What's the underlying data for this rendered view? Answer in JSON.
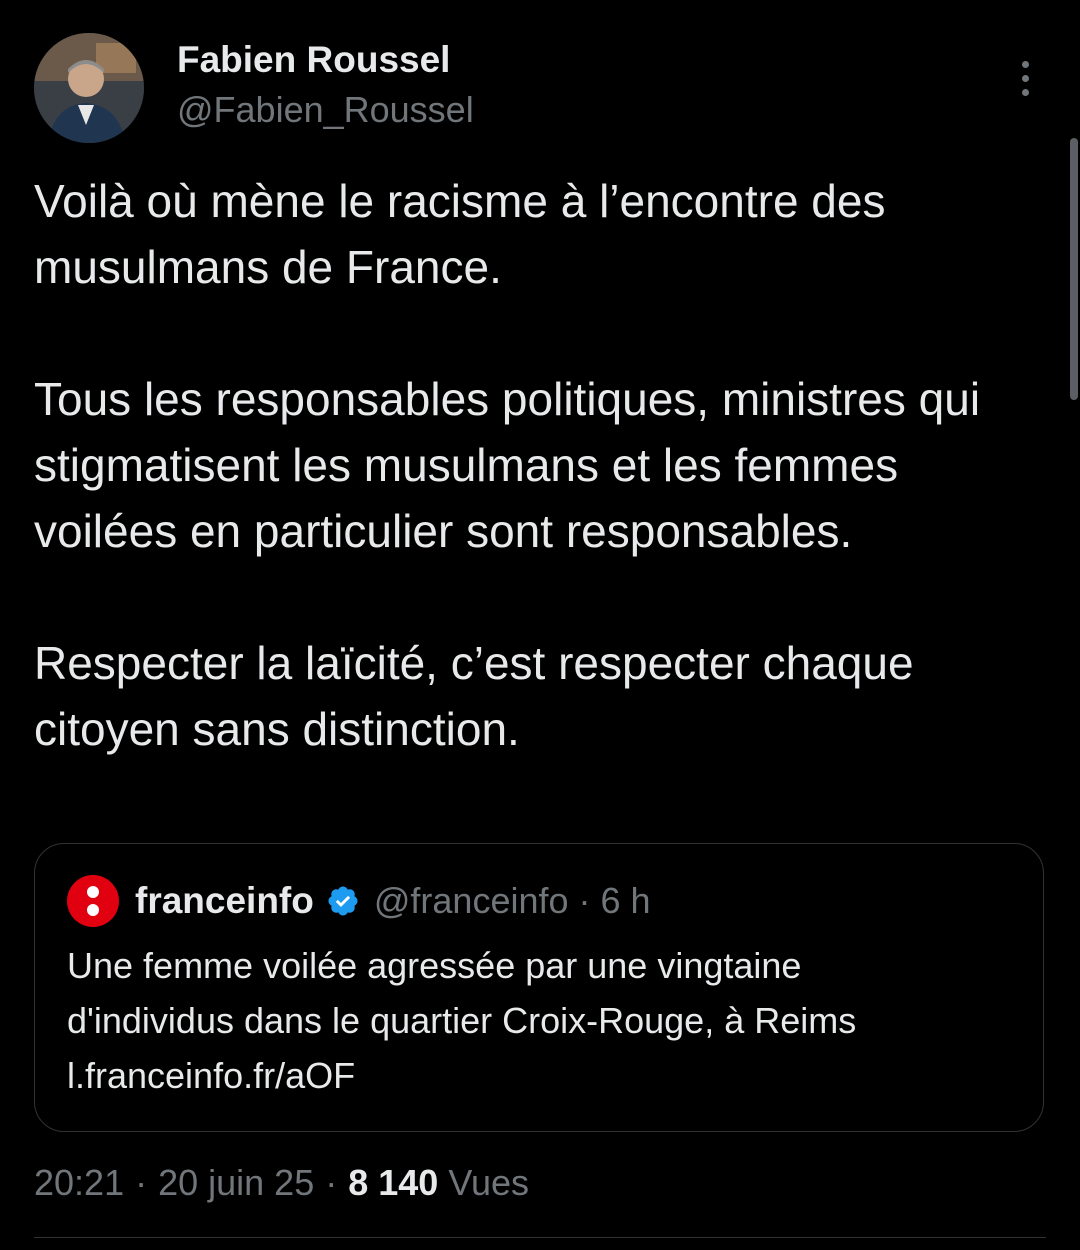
{
  "author": {
    "name": "Fabien Roussel",
    "handle": "@Fabien_Roussel"
  },
  "tweet": {
    "paragraphs": [
      "Voilà où mène le racisme à l’encontre des musulmans de France.",
      "Tous les responsables politiques, ministres qui stigmatisent les musulmans et les femmes voilées en particulier sont responsables.",
      "Respecter la laïcité, c’est respecter chaque citoyen sans distinction."
    ]
  },
  "quote": {
    "name": "franceinfo",
    "handle": "@franceinfo",
    "separator": "·",
    "time": "6 h",
    "lines": [
      "Une femme voilée agressée par une vingtaine",
      "d'individus dans le quartier Croix-Rouge, à Reims",
      "l.franceinfo.fr/aOF"
    ]
  },
  "meta": {
    "time": "20:21",
    "sep": "·",
    "date": "20 juin 25",
    "views_count": "8 140",
    "views_label": "Vues"
  },
  "icons": {
    "more": "more-vertical-icon",
    "verified": "verified-badge-icon",
    "quote_logo": "franceinfo-logo"
  },
  "colors": {
    "background": "#000000",
    "text": "#e7e9ea",
    "secondary": "#71767b",
    "border": "#2f3336",
    "verified": "#1d9bf0",
    "franceinfo_red": "#e1000f"
  }
}
